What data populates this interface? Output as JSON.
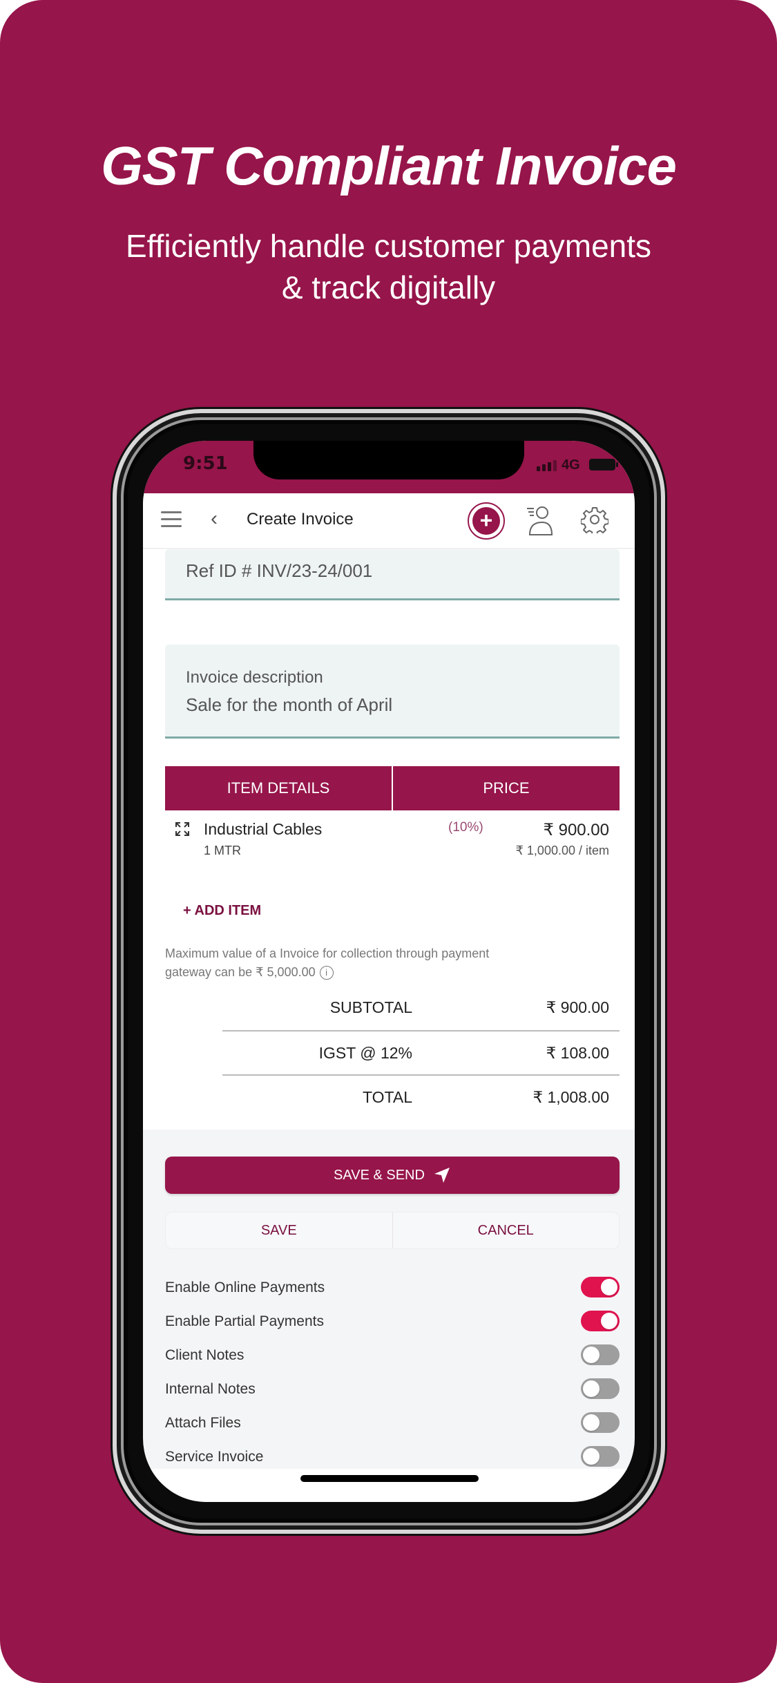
{
  "promo": {
    "headline": "GST Compliant Invoice",
    "subline_1": "Efficiently handle customer payments",
    "subline_2": "& track digitally",
    "brand_color": "#96154a"
  },
  "status_bar": {
    "time": "9:51",
    "network": "4G"
  },
  "app_bar": {
    "title": "Create Invoice",
    "icons": [
      "menu-icon",
      "back-icon",
      "add-icon",
      "profile-icon",
      "gear-icon"
    ]
  },
  "form": {
    "ref_id": "Ref ID #  INV/23-24/001",
    "description_label": "Invoice description",
    "description_value": "Sale for the month of April"
  },
  "items_table": {
    "headers": [
      "ITEM DETAILS",
      "PRICE"
    ],
    "rows": [
      {
        "name": "Industrial Cables",
        "quantity": "1 MTR",
        "discount": "(10%)",
        "amount": "₹ 900.00",
        "unit_price": "₹ 1,000.00 / item"
      }
    ]
  },
  "add_item_label": "+ ADD ITEM",
  "gateway_note": "Maximum value of a Invoice for collection through payment gateway can be ₹ 5,000.00",
  "info_icon_glyph": "i",
  "totals": [
    {
      "label": "SUBTOTAL",
      "amount": "₹ 900.00"
    },
    {
      "label": "IGST @ 12%",
      "amount": "₹ 108.00"
    },
    {
      "label": "TOTAL",
      "amount": "₹ 1,008.00"
    }
  ],
  "actions": {
    "save_send": "SAVE & SEND",
    "save": "SAVE",
    "cancel": "CANCEL"
  },
  "toggles": [
    {
      "label": "Enable Online Payments",
      "on": true
    },
    {
      "label": "Enable Partial Payments",
      "on": true
    },
    {
      "label": "Client Notes",
      "on": false
    },
    {
      "label": "Internal Notes",
      "on": false
    },
    {
      "label": "Attach Files",
      "on": false
    },
    {
      "label": "Service Invoice",
      "on": false
    }
  ],
  "colors": {
    "toggle_on": "#e0134f",
    "toggle_off": "#9e9e9e",
    "field_underline": "#7faaa6"
  }
}
